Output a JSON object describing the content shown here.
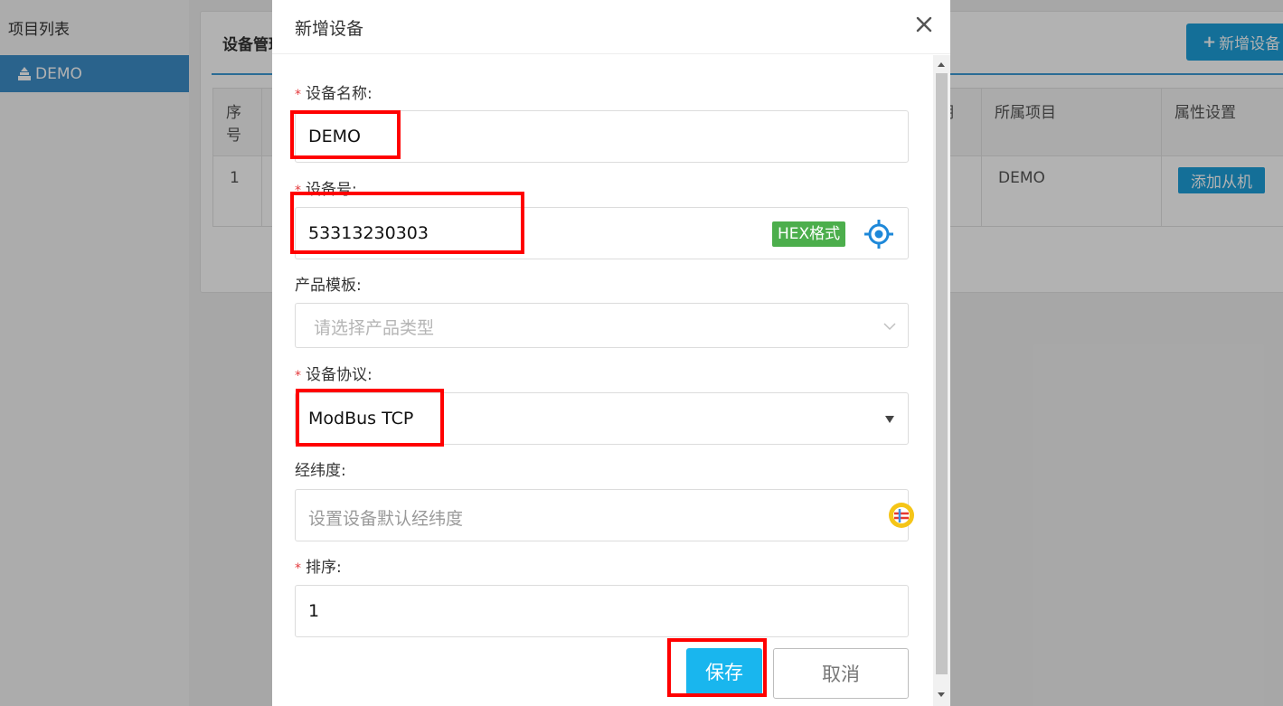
{
  "sidebar": {
    "title": "项目列表",
    "items": [
      {
        "label": "DEMO"
      }
    ]
  },
  "panel": {
    "title": "设备管理",
    "add_button": "新增设备"
  },
  "table": {
    "headers": [
      "序号",
      "所属项目",
      "属性设置"
    ],
    "partial_header": "期",
    "rows": [
      {
        "index": "1",
        "project": "DEMO",
        "action": "添加从机"
      }
    ]
  },
  "modal": {
    "title": "新增设备",
    "fields": {
      "name": {
        "label": "设备名称:",
        "value": "DEMO"
      },
      "number": {
        "label": "设备号:",
        "value": "53313230303",
        "badge": "HEX格式"
      },
      "template": {
        "label": "产品模板:",
        "placeholder": "请选择产品类型"
      },
      "protocol": {
        "label": "设备协议:",
        "value": "ModBus TCP"
      },
      "location": {
        "label": "经纬度:",
        "placeholder": "设置设备默认经纬度"
      },
      "sort": {
        "label": "排序:",
        "value": "1"
      }
    },
    "required_mark": "*",
    "save": "保存",
    "cancel": "取消"
  },
  "colors": {
    "accent": "#1ea0da",
    "sidebar_active": "#3d8ec9",
    "badge_green": "#4cae4c",
    "annotation_red": "#ff0000"
  }
}
